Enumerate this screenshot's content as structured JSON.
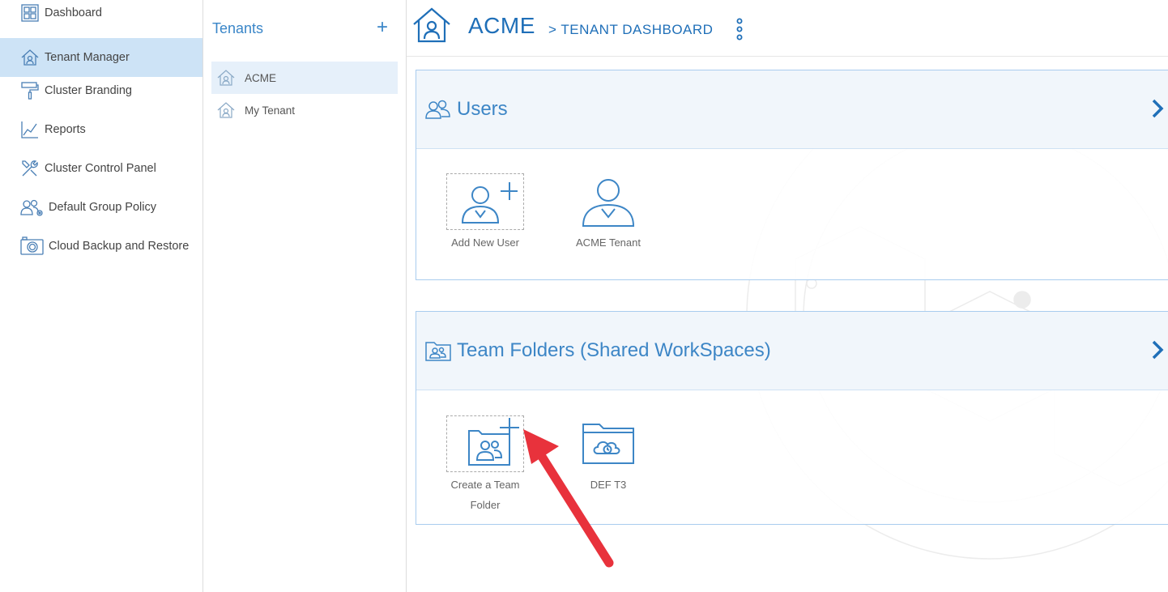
{
  "nav": {
    "items": [
      {
        "label": "Dashboard",
        "icon": "dashboard-icon"
      },
      {
        "label": "Tenant Manager",
        "icon": "tenant-home-icon",
        "active": true
      },
      {
        "label": "Cluster Branding",
        "icon": "paint-roller-icon"
      },
      {
        "label": "Reports",
        "icon": "chart-icon"
      },
      {
        "label": "Cluster Control Panel",
        "icon": "tools-icon"
      },
      {
        "label": "Default Group Policy",
        "icon": "group-policy-icon"
      },
      {
        "label": "Cloud Backup and Restore",
        "icon": "camera-icon"
      }
    ]
  },
  "tenants": {
    "title": "Tenants",
    "add_label": "+",
    "items": [
      {
        "label": "ACME",
        "active": true
      },
      {
        "label": "My Tenant"
      }
    ]
  },
  "header": {
    "title": "ACME",
    "subtitle": "> TENANT DASHBOARD"
  },
  "users_panel": {
    "title": "Users",
    "tiles": [
      {
        "label": "Add New User",
        "icon": "add-user-icon"
      },
      {
        "label": "ACME Tenant",
        "icon": "user-icon"
      }
    ]
  },
  "folders_panel": {
    "title": "Team Folders (Shared WorkSpaces)",
    "tiles": [
      {
        "label": "Create a Team Folder",
        "icon": "add-team-folder-icon"
      },
      {
        "label": "DEF T3",
        "icon": "cloud-folder-icon"
      }
    ]
  },
  "colors": {
    "accent": "#3a86c8",
    "active_nav": "#cde3f6",
    "arrow": "#e8323c"
  }
}
